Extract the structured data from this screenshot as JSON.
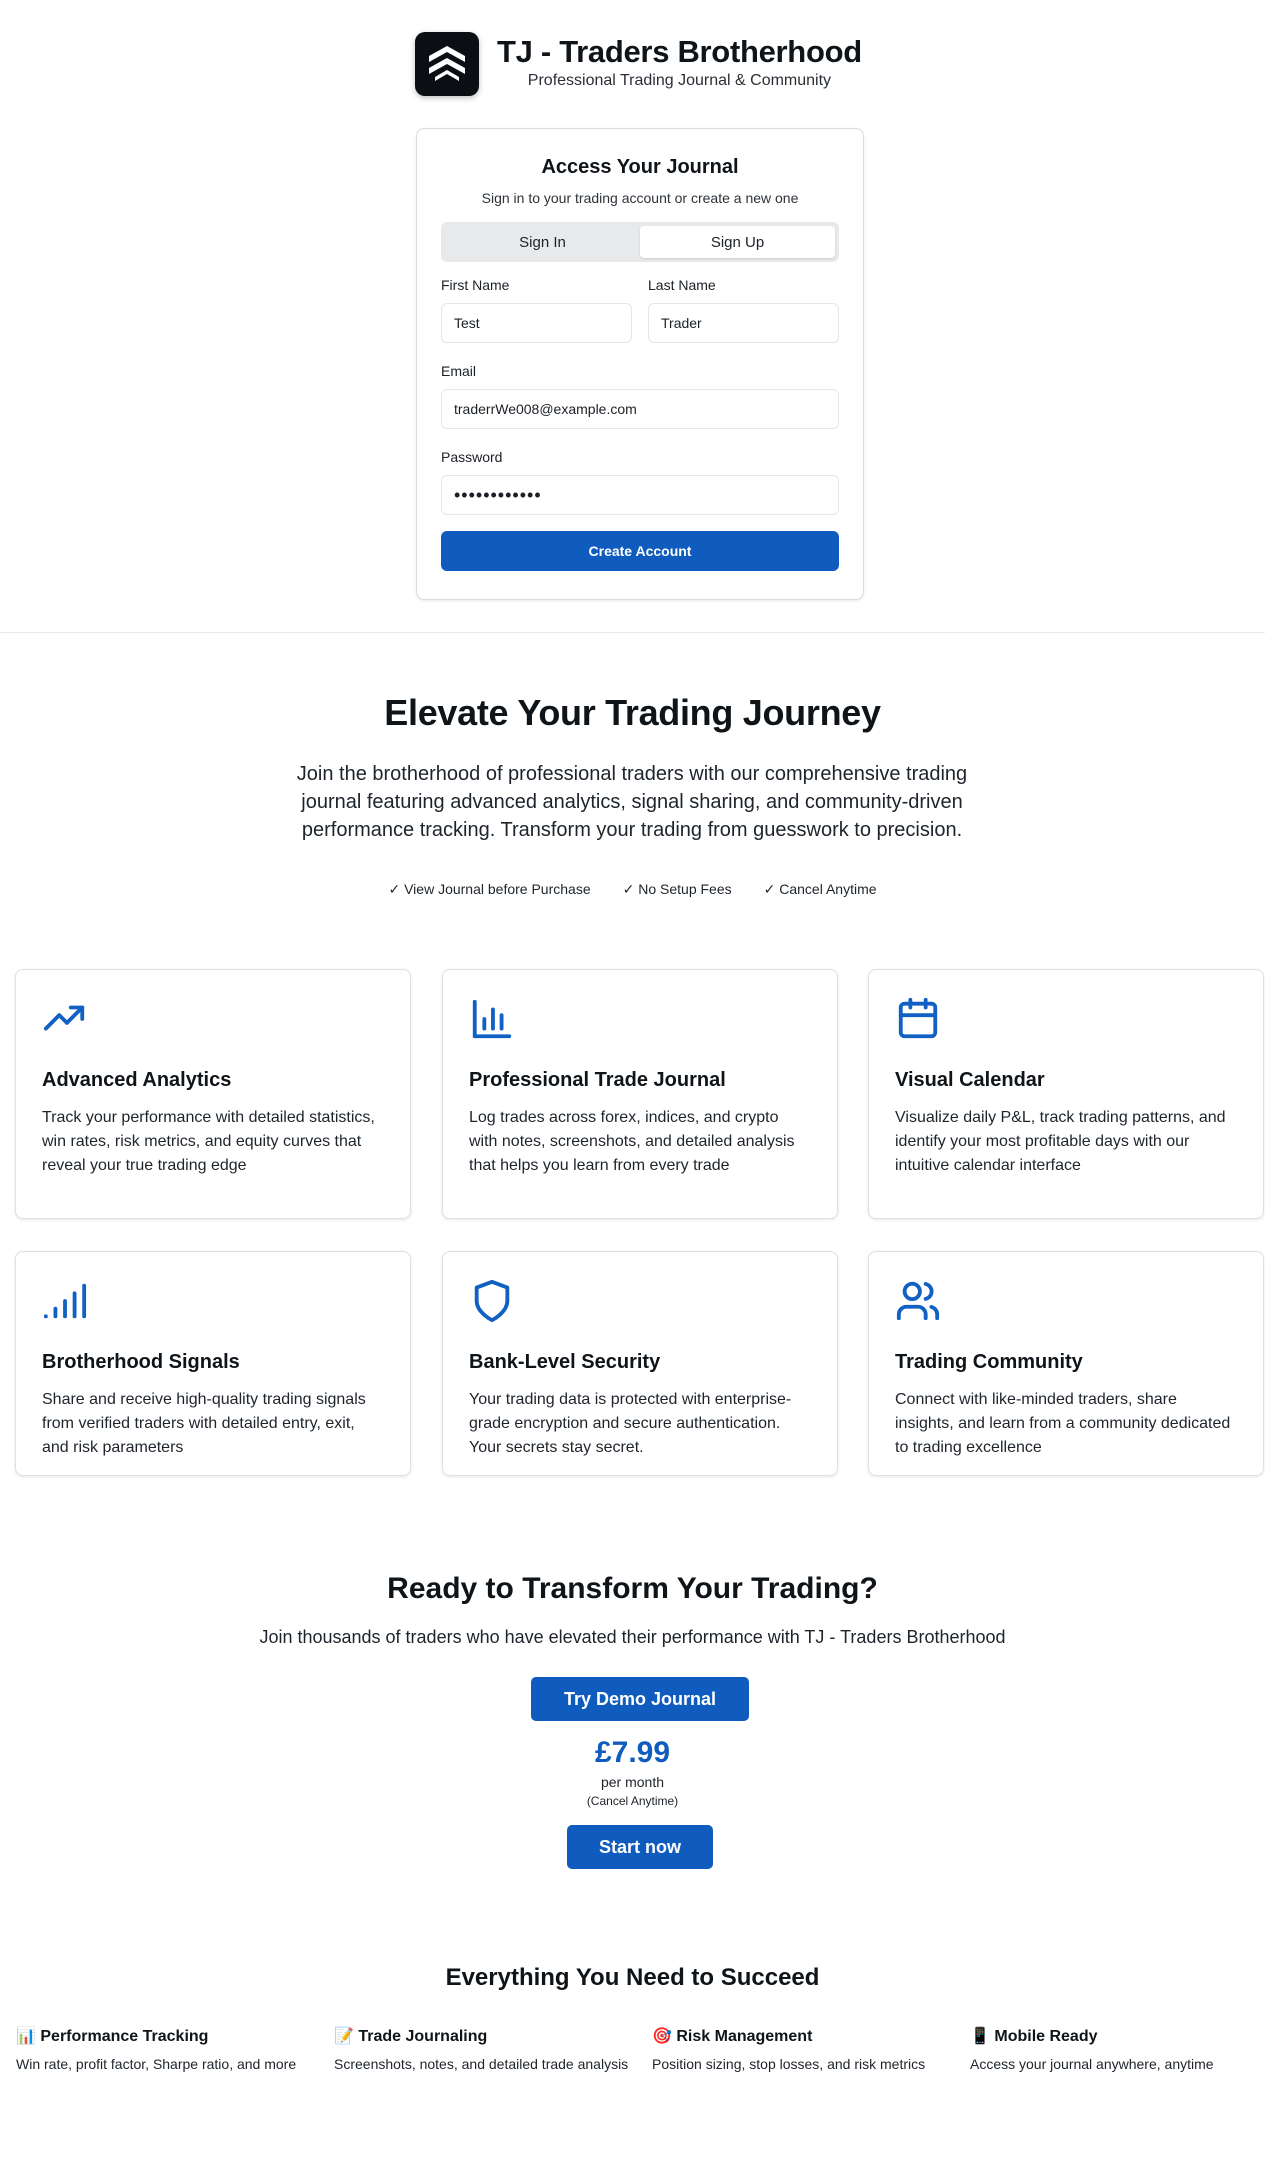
{
  "brand": {
    "title": "TJ - Traders Brotherhood",
    "subtitle": "Professional Trading Journal & Community",
    "logo_icon": "chevrons-up-icon"
  },
  "auth": {
    "title": "Access Your Journal",
    "subtitle": "Sign in to your trading account or create a new one",
    "tabs": {
      "sign_in": "Sign In",
      "sign_up": "Sign Up",
      "active": "Sign Up"
    },
    "first_name": {
      "label": "First Name",
      "value": "Test"
    },
    "last_name": {
      "label": "Last Name",
      "value": "Trader"
    },
    "email": {
      "label": "Email",
      "value": "traderrWe008@example.com"
    },
    "password": {
      "label": "Password",
      "value": "••••••••••••"
    },
    "submit_label": "Create Account"
  },
  "hero": {
    "title": "Elevate Your Trading Journey",
    "description": "Join the brotherhood of professional traders with our comprehensive trading journal featuring advanced analytics, signal sharing, and community-driven performance tracking. Transform your trading from guesswork to precision.",
    "checks": [
      "✓ View Journal before Purchase",
      "✓ No Setup Fees",
      "✓ Cancel Anytime"
    ]
  },
  "features": [
    {
      "icon": "trending-up-icon",
      "title": "Advanced Analytics",
      "description": "Track your performance with detailed statistics, win rates, risk metrics, and equity curves that reveal your true trading edge"
    },
    {
      "icon": "bar-chart-icon",
      "title": "Professional Trade Journal",
      "description": "Log trades across forex, indices, and crypto with notes, screenshots, and detailed analysis that helps you learn from every trade"
    },
    {
      "icon": "calendar-icon",
      "title": "Visual Calendar",
      "description": "Visualize daily P&L, track trading patterns, and identify your most profitable days with our intuitive calendar interface"
    },
    {
      "icon": "signal-icon",
      "title": "Brotherhood Signals",
      "description": "Share and receive high-quality trading signals from verified traders with detailed entry, exit, and risk parameters"
    },
    {
      "icon": "shield-icon",
      "title": "Bank-Level Security",
      "description": "Your trading data is protected with enterprise-grade encryption and secure authentication. Your secrets stay secret."
    },
    {
      "icon": "users-icon",
      "title": "Trading Community",
      "description": "Connect with like-minded traders, share insights, and learn from a community dedicated to trading excellence"
    }
  ],
  "cta": {
    "title": "Ready to Transform Your Trading?",
    "subtitle": "Join thousands of traders who have elevated their performance with TJ - Traders Brotherhood",
    "demo_label": "Try Demo Journal",
    "price": "£7.99",
    "per": "per month",
    "cancel": "(Cancel Anytime)",
    "start_label": "Start now"
  },
  "everything": {
    "title": "Everything You Need to Succeed",
    "items": [
      {
        "title": "📊 Performance Tracking",
        "description": "Win rate, profit factor, Sharpe ratio, and more"
      },
      {
        "title": "📝 Trade Journaling",
        "description": "Screenshots, notes, and detailed trade analysis"
      },
      {
        "title": "🎯 Risk Management",
        "description": "Position sizing, stop losses, and risk metrics"
      },
      {
        "title": "📱 Mobile Ready",
        "description": "Access your journal anywhere, anytime"
      }
    ]
  },
  "colors": {
    "accent": "#0f5cbe",
    "text": "#0f1419"
  }
}
